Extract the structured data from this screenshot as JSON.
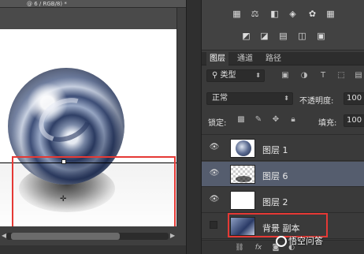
{
  "document": {
    "tab_title": "@ 6 / RGB/8) *"
  },
  "layers_panel": {
    "tabs": [
      "图层",
      "通道",
      "路径"
    ],
    "filter_kind": "类型",
    "blend_mode": "正常",
    "opacity_label": "不透明度:",
    "opacity_value": "100",
    "lock_label": "锁定:",
    "fill_label": "填充:",
    "fill_value": "100",
    "layers": [
      {
        "name": "图层 1",
        "visible": true,
        "selected": false,
        "thumbnail": "globe"
      },
      {
        "name": "图层 6",
        "visible": true,
        "selected": true,
        "thumbnail": "shadow"
      },
      {
        "name": "图层 2",
        "visible": true,
        "selected": false,
        "thumbnail": "white"
      },
      {
        "name": "背景 副本",
        "visible": false,
        "selected": false,
        "thumbnail": "background"
      }
    ]
  },
  "watermark": {
    "text": "悟空问答"
  },
  "colors": {
    "selection_outline": "#e53935",
    "selected_layer_bg": "#555d6e",
    "panel_bg": "#3a3a3a"
  },
  "icons": {
    "adjustments_row1": [
      "brightness-icon",
      "levels-icon",
      "curves-icon",
      "exposure-icon",
      "vibrance-icon",
      "hue-saturation-icon"
    ],
    "adjustments_row2": [
      "color-balance-icon",
      "black-white-icon",
      "photo-filter-icon",
      "channel-mixer-icon",
      "color-lookup-icon"
    ],
    "filter_icons": [
      "pixel-filter-icon",
      "adjustment-filter-icon",
      "type-filter-icon",
      "shape-filter-icon",
      "smart-object-filter-icon"
    ],
    "lock_icons": [
      "lock-transparent-icon",
      "lock-pixels-icon",
      "lock-position-icon",
      "lock-all-icon"
    ],
    "footer_icons": [
      "link-icon",
      "fx-icon",
      "mask-icon",
      "adjustment-layer-icon",
      "group-icon",
      "new-layer-icon",
      "trash-icon"
    ]
  }
}
